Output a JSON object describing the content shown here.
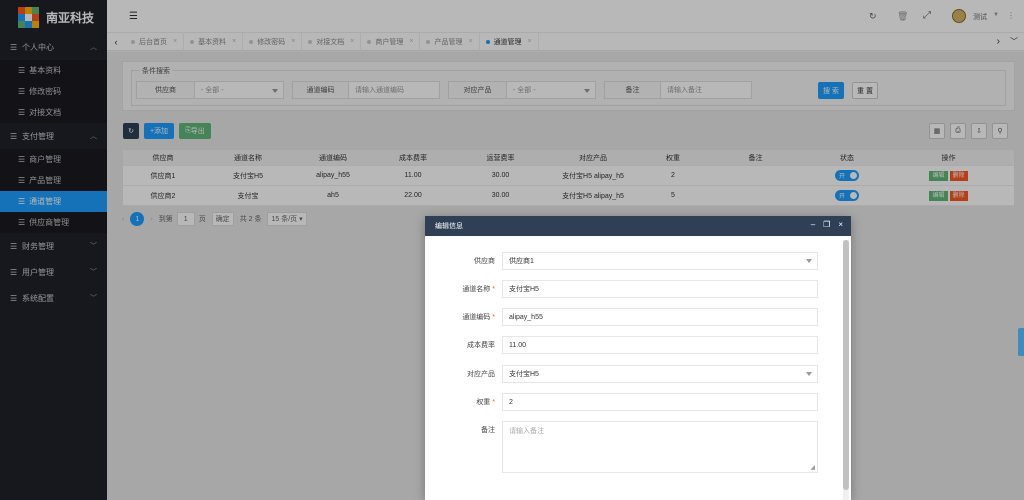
{
  "app": {
    "title": "南亚科技"
  },
  "sidebar": {
    "groups": [
      {
        "label": "个人中心",
        "icon": "list-icon",
        "expanded": true,
        "items": [
          "基本资料",
          "修改密码",
          "对接文档"
        ]
      },
      {
        "label": "支付管理",
        "icon": "list-icon",
        "expanded": true,
        "items": [
          "商户管理",
          "产品管理",
          "通道管理",
          "供应商管理"
        ],
        "active": "通道管理"
      },
      {
        "label": "财务管理",
        "icon": "list-icon",
        "expanded": false
      },
      {
        "label": "用户管理",
        "icon": "list-icon",
        "expanded": false
      },
      {
        "label": "系统配置",
        "icon": "list-icon",
        "expanded": false
      }
    ]
  },
  "topbar": {
    "user": "测试",
    "icons": [
      "menu-toggle-icon",
      "refresh-icon",
      "trash-icon",
      "fullscreen-icon",
      "avatar-icon"
    ]
  },
  "tabs": [
    "后台首页",
    "基本资料",
    "修改密码",
    "对接文档",
    "商户管理",
    "产品管理",
    "通道管理"
  ],
  "active_tab": "通道管理",
  "search": {
    "title": "条件搜索",
    "fields": [
      {
        "label": "供应商",
        "value": "- 全部 -",
        "type": "select"
      },
      {
        "label": "通道编码",
        "placeholder": "请输入通道编码",
        "type": "input"
      },
      {
        "label": "对应产品",
        "value": "- 全部 -",
        "type": "select"
      },
      {
        "label": "备注",
        "placeholder": "请输入备注",
        "type": "input"
      }
    ],
    "search_label": "搜 索",
    "reset_label": "重 置"
  },
  "toolbar": {
    "add_label": "添加",
    "export_label": "导出"
  },
  "table": {
    "headers": [
      "供应商",
      "通道名称",
      "通道编码",
      "成本费率",
      "运营费率",
      "对应产品",
      "权重",
      "备注",
      "状态",
      "操作"
    ],
    "rows": [
      [
        "供应商1",
        "支付宝H5",
        "alipay_h55",
        "11.00",
        "30.00",
        "支付宝H5 alipay_h5",
        "2",
        "",
        "开",
        ""
      ],
      [
        "供应商2",
        "支付宝",
        "ah5",
        "22.00",
        "30.00",
        "支付宝H5 alipay_h5",
        "5",
        "",
        "开",
        ""
      ]
    ],
    "edit_label": "编辑",
    "delete_label": "删除"
  },
  "pager": {
    "current": "1",
    "goto_label": "到第",
    "page_input": "1",
    "page_unit": "页",
    "confirm": "确定",
    "total": "共 2 条",
    "per_page": "15 条/页"
  },
  "modal": {
    "title": "编辑信息",
    "fields": [
      {
        "label": "供应商",
        "value": "供应商1",
        "required": false,
        "type": "select"
      },
      {
        "label": "通道名称",
        "value": "支付宝H5",
        "required": true,
        "type": "input"
      },
      {
        "label": "通道编码",
        "value": "alipay_h55",
        "required": true,
        "type": "input"
      },
      {
        "label": "成本费率",
        "value": "11.00",
        "required": false,
        "type": "input"
      },
      {
        "label": "对应产品",
        "value": "支付宝H5",
        "required": false,
        "type": "select"
      },
      {
        "label": "权重",
        "value": "2",
        "required": true,
        "type": "input"
      },
      {
        "label": "备注",
        "placeholder": "请输入备注",
        "required": false,
        "type": "textarea"
      }
    ]
  },
  "colors": {
    "sidebar": "#20222a",
    "accent": "#1e9fff",
    "green": "#5fb878",
    "red": "#ff5722",
    "modal_header": "#2f4056"
  }
}
